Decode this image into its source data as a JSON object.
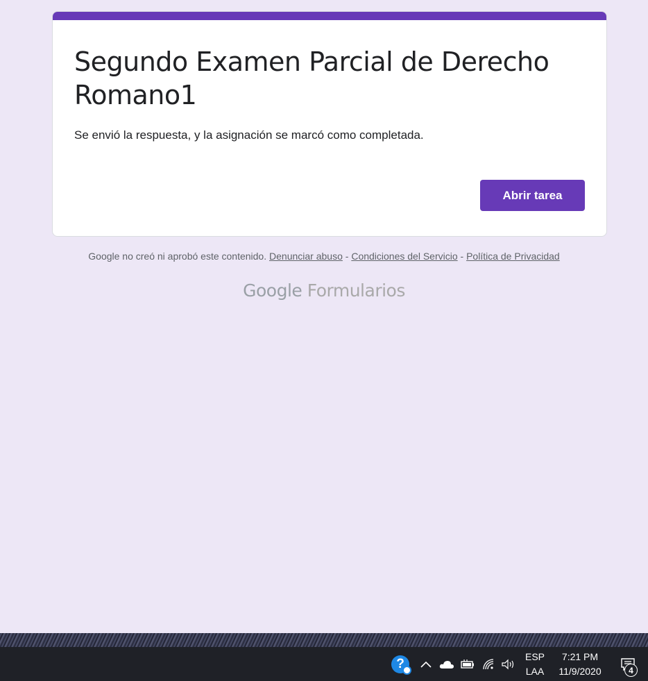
{
  "form": {
    "title": "Segundo Examen Parcial de Derecho Romano1",
    "message": "Se envió la respuesta, y la asignación se marcó como completada.",
    "open_button_label": "Abrir tarea",
    "accent_color": "#673ab7"
  },
  "footer": {
    "disclaimer": "Google no creó ni aprobó este contenido.",
    "report_abuse": "Denunciar abuso",
    "separator": "-",
    "terms": "Condiciones del Servicio",
    "privacy": "Política de Privacidad"
  },
  "brand": {
    "google": "Google",
    "product": "Formularios"
  },
  "taskbar": {
    "language_top": "ESP",
    "language_bottom": "LAA",
    "time": "7:21 PM",
    "date": "11/9/2020",
    "notification_count": "4",
    "help_icon": "help-question-icon",
    "tray_icons": [
      "chevron-up-icon",
      "onedrive-cloud-icon",
      "battery-icon",
      "wifi-icon",
      "volume-icon"
    ]
  }
}
